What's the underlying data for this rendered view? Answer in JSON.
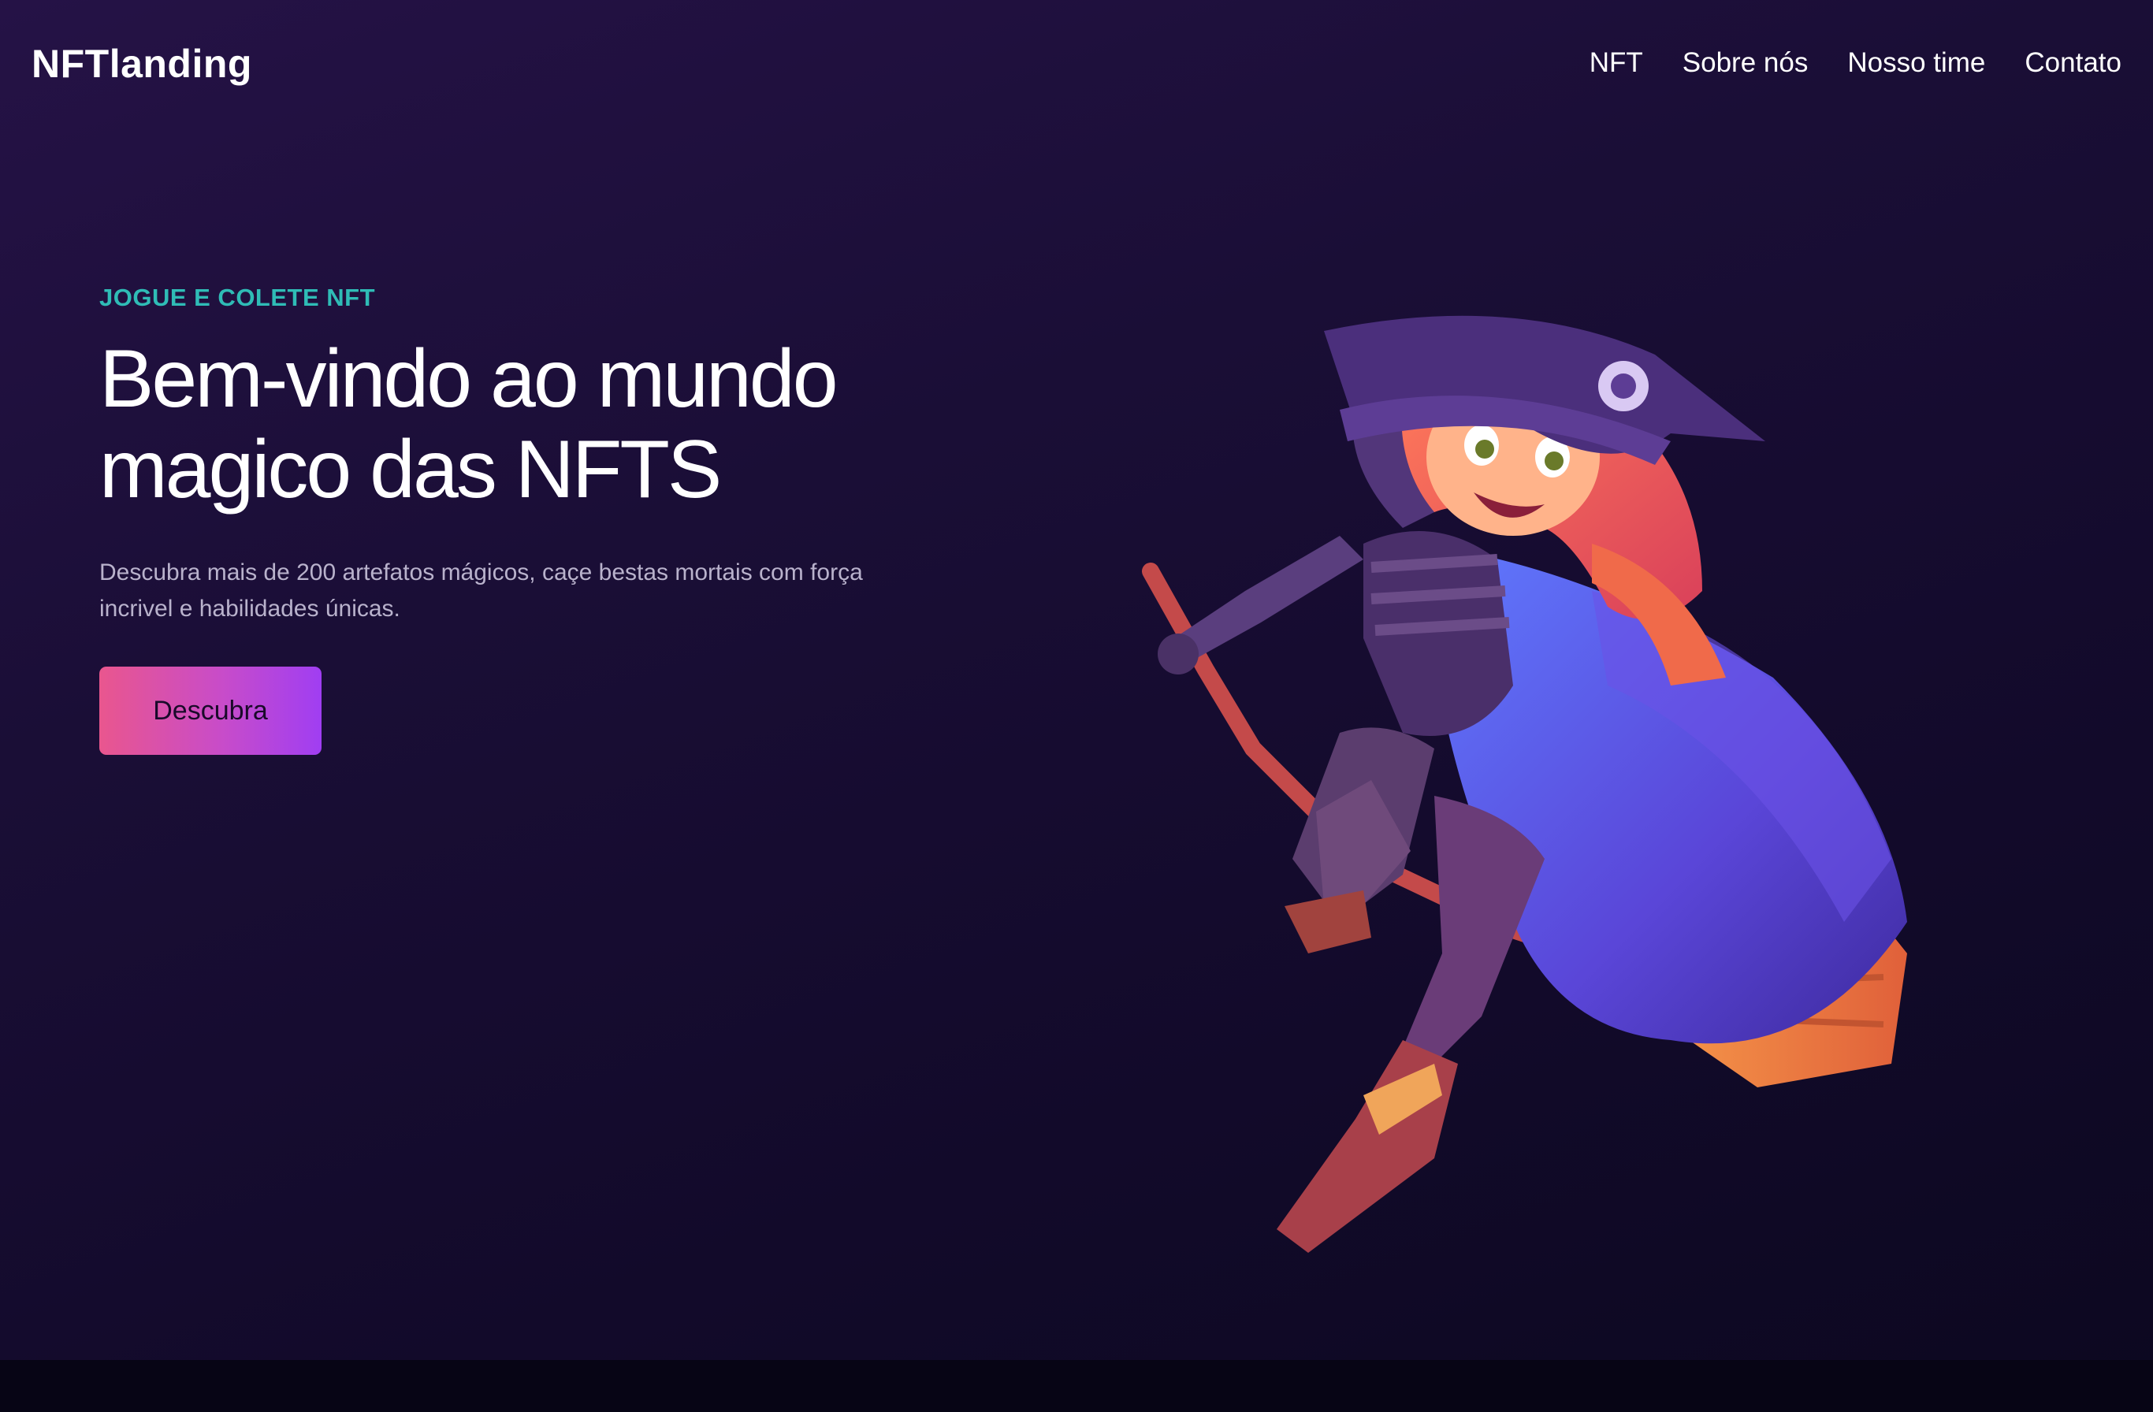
{
  "header": {
    "logo": "NFTlanding",
    "nav": [
      "NFT",
      "Sobre nós",
      "Nosso time",
      "Contato"
    ]
  },
  "hero": {
    "eyebrow": "JOGUE E COLETE NFT",
    "title_line1": "Bem-vindo ao mundo",
    "title_line2": "magico das NFTS",
    "description": "Descubra mais de 200 artefatos mágicos, caçe bestas mortais com força incrivel e habilidades únicas.",
    "cta_label": "Descubra"
  },
  "illustration": {
    "icon": "witch-on-broom-illustration"
  },
  "colors": {
    "background": "#1a0e36",
    "accent_teal": "#2fbcb6",
    "button_gradient_start": "#e9568e",
    "button_gradient_end": "#a03ef2",
    "footer_band": "#070515"
  }
}
